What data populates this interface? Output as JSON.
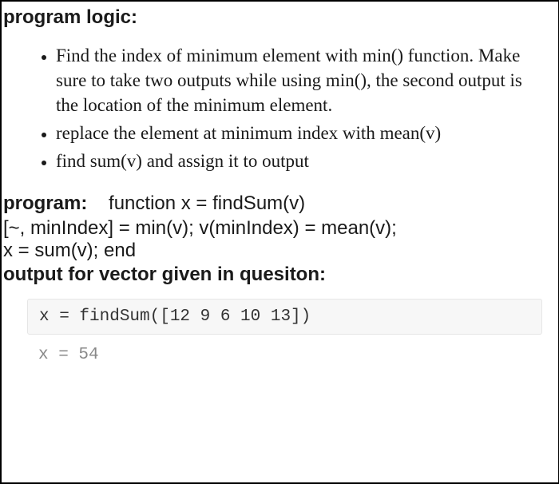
{
  "heading_logic": "program logic:",
  "bullets": [
    "Find the index of minimum element with min() function. Make sure to take two outputs while using min(), the second output is the location of the minimum element.",
    "replace the element at minimum index with mean(v)",
    "find sum(v) and assign it to output"
  ],
  "program_label": "program:",
  "program_signature": "function x = findSum(v)",
  "program_body_line1": "[~, minIndex] = min(v); v(minIndex) = mean(v);",
  "program_body_line2": "x = sum(v); end",
  "output_label": "output for vector given in quesiton:",
  "code_input": "x = findSum([12 9 6 10 13])",
  "code_output": "x = 54"
}
